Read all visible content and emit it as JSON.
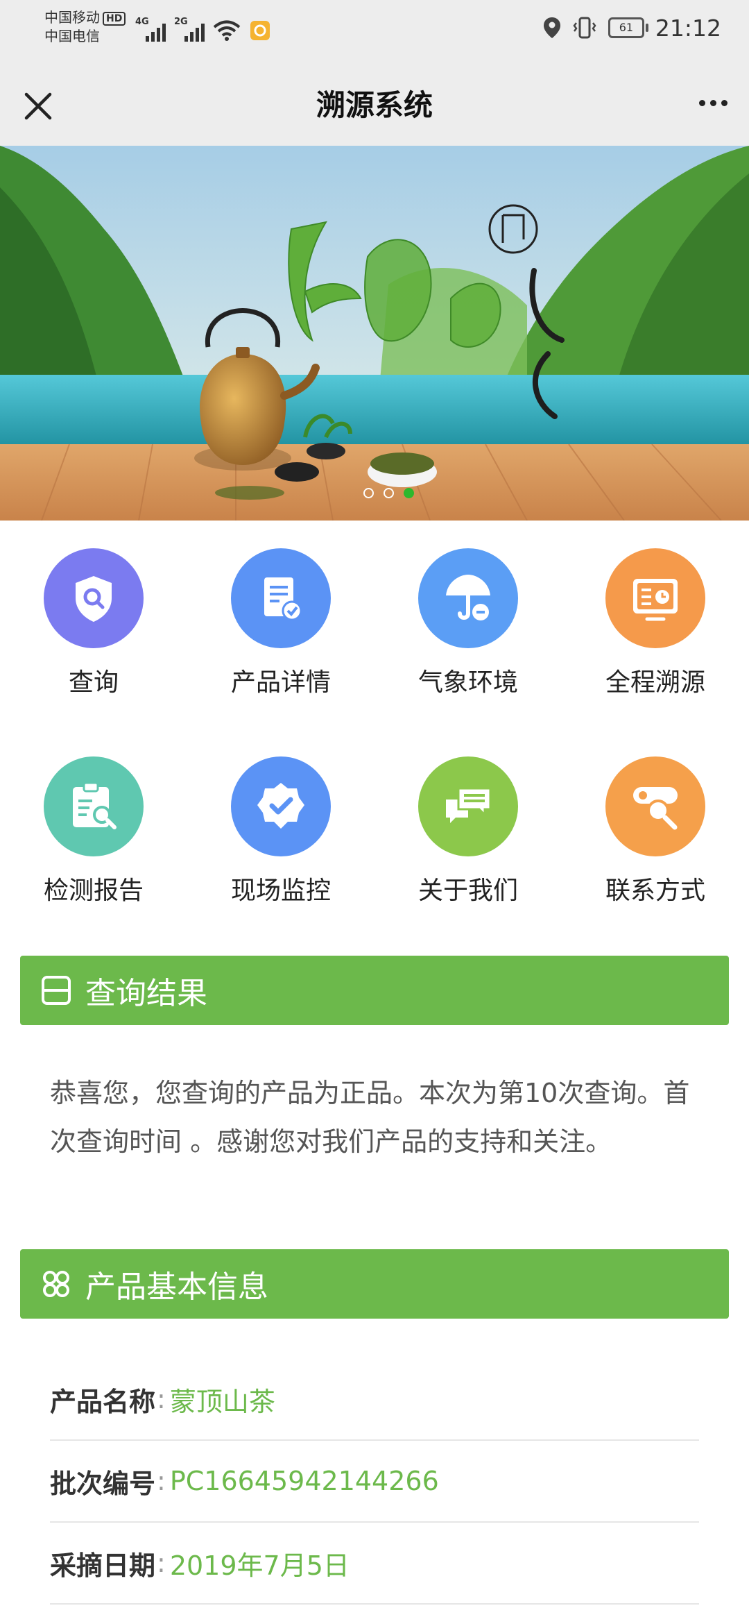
{
  "status_bar": {
    "carrier1": "中国移动",
    "hd": "HD",
    "carrier2": "中国电信",
    "sig1": "4G",
    "sig2": "2G",
    "battery": "61",
    "time": "21:12"
  },
  "nav": {
    "title": "溯源系统"
  },
  "banner": {
    "slides": 3,
    "active_slide": 3
  },
  "menu": [
    {
      "label": "查询",
      "icon": "shield-search-icon",
      "color": "#7b7bf0"
    },
    {
      "label": "产品详情",
      "icon": "document-check-icon",
      "color": "#5b93f5"
    },
    {
      "label": "气象环境",
      "icon": "umbrella-icon",
      "color": "#5b9ef5"
    },
    {
      "label": "全程溯源",
      "icon": "clock-card-icon",
      "color": "#f59a4b"
    },
    {
      "label": "检测报告",
      "icon": "clipboard-search-icon",
      "color": "#5fc8b0"
    },
    {
      "label": "现场监控",
      "icon": "badge-check-icon",
      "color": "#5b93f5"
    },
    {
      "label": "关于我们",
      "icon": "chat-bubbles-icon",
      "color": "#8cc84b"
    },
    {
      "label": "联系方式",
      "icon": "magnifier-card-icon",
      "color": "#f5a04b"
    }
  ],
  "result": {
    "title": "查询结果",
    "text": "恭喜您，您查询的产品为正品。本次为第10次查询。首次查询时间 。感谢您对我们产品的支持和关注。"
  },
  "basic_info": {
    "title": "产品基本信息",
    "separator": ":",
    "rows": [
      {
        "label": "产品名称",
        "value": "蒙顶山茶"
      },
      {
        "label": "批次编号",
        "value": "PC16645942144266"
      },
      {
        "label": "采摘日期",
        "value": "2019年7月5日"
      }
    ]
  },
  "colors": {
    "accent": "#6cb94b",
    "status_bg": "#ededed"
  }
}
